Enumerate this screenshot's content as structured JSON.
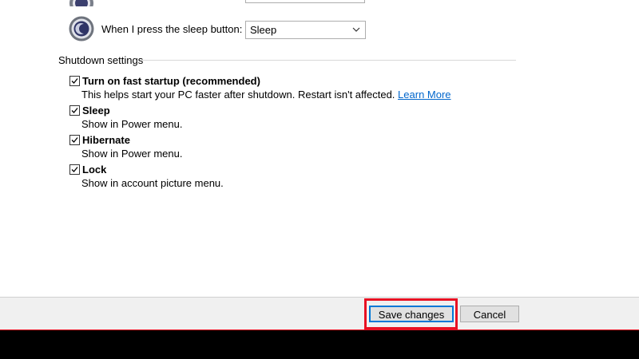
{
  "power_actions": {
    "sleep_button": {
      "label": "When I press the sleep button:",
      "selected": "Sleep",
      "icon": "moon-power-icon"
    }
  },
  "shutdown_settings": {
    "title": "Shutdown settings",
    "options": [
      {
        "label": "Turn on fast startup (recommended)",
        "description": "This helps start your PC faster after shutdown. Restart isn't affected.",
        "link": "Learn More",
        "checked": true
      },
      {
        "label": "Sleep",
        "description": "Show in Power menu.",
        "checked": true
      },
      {
        "label": "Hibernate",
        "description": "Show in Power menu.",
        "checked": true
      },
      {
        "label": "Lock",
        "description": "Show in account picture menu.",
        "checked": true
      }
    ]
  },
  "footer": {
    "save_label": "Save changes",
    "cancel_label": "Cancel"
  },
  "colors": {
    "accent": "#0078d7",
    "highlight": "#e81123",
    "link": "#0066cc"
  }
}
